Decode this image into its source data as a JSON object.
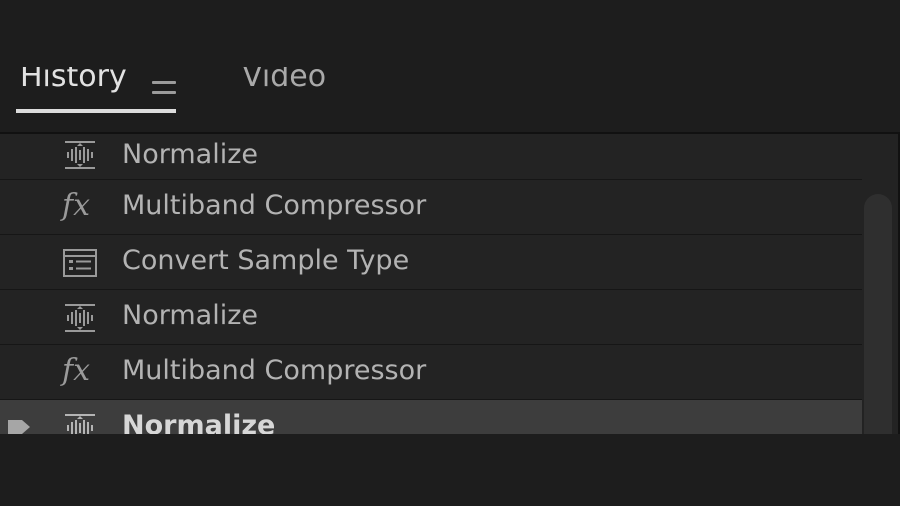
{
  "tabs": [
    {
      "label": "History",
      "active": true
    },
    {
      "label": "Video",
      "active": false
    }
  ],
  "panel_menu": {
    "icon": "hamburger-menu-icon"
  },
  "history": {
    "items": [
      {
        "label": "Normalize",
        "icon": "normalize-icon"
      },
      {
        "label": "Multiband Compressor",
        "icon": "fx-icon"
      },
      {
        "label": "Convert Sample Type",
        "icon": "convert-sample-type-icon"
      },
      {
        "label": "Normalize",
        "icon": "normalize-icon"
      },
      {
        "label": "Multiband Compressor",
        "icon": "fx-icon"
      },
      {
        "label": "Normalize",
        "icon": "normalize-icon",
        "selected": true
      }
    ],
    "fx_glyph": "fx",
    "current_marker_icon": "current-state-marker-icon"
  },
  "colors": {
    "background": "#1d1d1d",
    "list_background": "#232323",
    "selected_row": "#3d3d3d",
    "text": "#b3b3b3",
    "active_tab_underline": "#dcdcdc"
  }
}
